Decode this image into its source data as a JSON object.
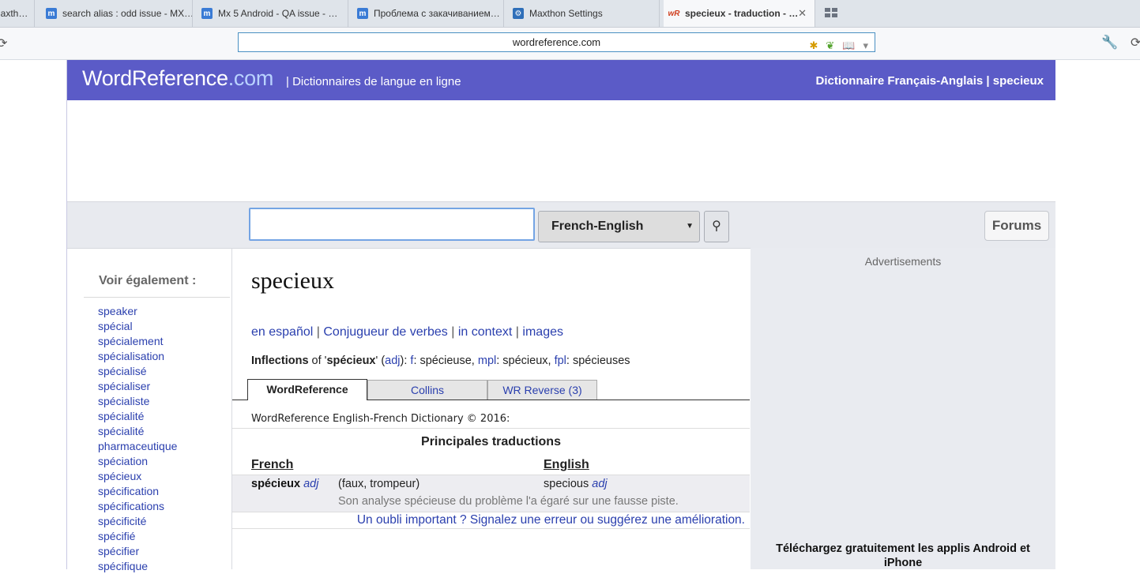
{
  "browser": {
    "tabs": [
      {
        "label": "laxth…",
        "icon": "maxthon-icon"
      },
      {
        "label": "search alias : odd issue - MX…",
        "icon": "maxthon-icon"
      },
      {
        "label": "Mx 5 Android - QA issue - …",
        "icon": "maxthon-icon"
      },
      {
        "label": "Проблема с закачиванием…",
        "icon": "maxthon-icon"
      },
      {
        "label": "Maxthon Settings",
        "icon": "gear-icon"
      },
      {
        "label": "specieux - traduction - …",
        "icon": "wordreference-icon",
        "favicon_text": "wR"
      }
    ],
    "address": "wordreference.com"
  },
  "site": {
    "logo_main": "WordReference",
    "logo_dot": ".com",
    "tagline": "| Dictionnaires de langue en ligne",
    "header_right": "Dictionnaire Français-Anglais | specieux",
    "accent_color": "#5b5bc7"
  },
  "search": {
    "value": "",
    "language": "French-English",
    "forums": "Forums"
  },
  "sidebar": {
    "title": "Voir également :",
    "items": [
      "speaker",
      "spécial",
      "spécialement",
      "spécialisation",
      "spécialisé",
      "spécialiser",
      "spécialiste",
      "spécialité",
      "spécialité",
      "pharmaceutique",
      "spéciation",
      "spécieux",
      "spécification",
      "spécifications",
      "spécificité",
      "spécifié",
      "spécifier",
      "spécifique"
    ]
  },
  "main": {
    "word": "specieux",
    "links": {
      "l1": "en español",
      "l2": "Conjugueur de verbes",
      "l3": "in context",
      "l4": "images"
    },
    "inflections": {
      "label": "Inflections",
      "of": "of '",
      "word": "spécieux",
      "close": "' (",
      "pos": "adj",
      "rest1": "): ",
      "f": "f",
      "f_val": ": spécieuse, ",
      "mpl": "mpl",
      "mpl_val": ": spécieux, ",
      "fpl": "fpl",
      "fpl_val": ": spécieuses"
    },
    "dict_tabs": [
      "WordReference",
      "Collins",
      "WR Reverse (3)"
    ],
    "copyright": "WordReference English-French Dictionary © 2016:",
    "section_title": "Principales traductions",
    "col_french": "French",
    "col_english": "English",
    "entry": {
      "word": "spécieux",
      "pos": "adj",
      "sense": "(faux, trompeur)",
      "translation": "specious",
      "translation_pos": "adj",
      "example": "Son analyse spécieuse du problème l'a égaré sur une fausse piste."
    },
    "report": "Un oubli important ? Signalez une erreur ou suggérez une amélioration."
  },
  "right": {
    "ads_label": "Advertisements",
    "apps_text": "Téléchargez gratuitement les applis Android et iPhone"
  }
}
